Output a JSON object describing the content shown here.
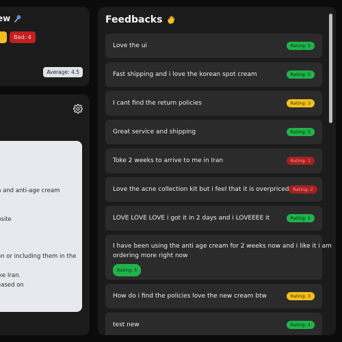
{
  "overview": {
    "title_fragment": "ew",
    "title_icon": "pin-icon",
    "bad_badge": "Bad: 4",
    "average": "Average: 4.5"
  },
  "analysis": {
    "settings_icon": "gear-icon",
    "lines": [
      "n and anti-age cream",
      "bsite",
      "on or including them in the",
      "ike Iran.",
      "eased on"
    ]
  },
  "feedback": {
    "title": "Feedbacks",
    "title_icon": "waving-hand-icon",
    "items": [
      {
        "text": "Love the ui",
        "rating": "Rating: 5",
        "color": "green"
      },
      {
        "text": "Fast shipping and i love the korean spot cream",
        "rating": "Rating: 5",
        "color": "green"
      },
      {
        "text": "I cant find the return policies",
        "rating": "Rating: 3",
        "color": "yellow"
      },
      {
        "text": "Great service and shipping",
        "rating": "Rating: 5",
        "color": "green"
      },
      {
        "text": "Toke 2 weeks to arrive to me in Iran",
        "rating": "Rating: 1",
        "color": "red"
      },
      {
        "text": "Love the acne collection kit but i feel that it is overpriced",
        "rating": "Rating: 2",
        "color": "red"
      },
      {
        "text": "LOVE LOVE LOVE i got it in 2 days and i LOVEEEE it",
        "rating": "Rating: 5",
        "color": "green"
      },
      {
        "text_line1": "I have been using the anti age cream for 2 weeks now and i like it i am",
        "text_line2": "ordering more right now",
        "rating": "Rating: 5",
        "color": "green"
      },
      {
        "text": "How do i find the policies love the new cream btw",
        "rating": "Rating: 3",
        "color": "yellow"
      },
      {
        "text": "test new",
        "rating": "Rating: 4",
        "color": "green"
      }
    ]
  },
  "colors": {
    "green": "#1fb34a",
    "yellow": "#f2c01d",
    "red": "#a82020"
  }
}
